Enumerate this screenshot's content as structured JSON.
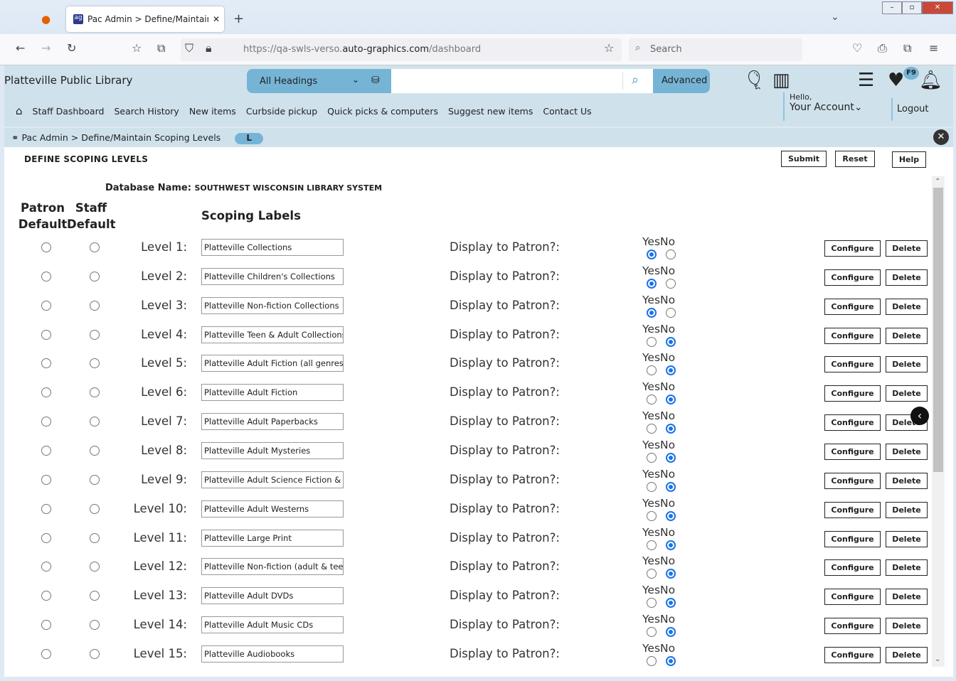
{
  "browser": {
    "tab_title": "Pac Admin > Define/Maintain S",
    "url_prefix": "https://qa-swls-verso.",
    "url_domain": "auto-graphics.com",
    "url_path": "/dashboard",
    "search_placeholder": "Search"
  },
  "header": {
    "library_name": "Platteville Public Library",
    "search_scope": "All Headings",
    "advanced_label": "Advanced",
    "badge": "F9",
    "hello": "Hello,",
    "account": "Your Account",
    "logout": "Logout"
  },
  "menu": [
    "Staff Dashboard",
    "Search History",
    "New items",
    "Curbside pickup",
    "Quick picks & computers",
    "Suggest new items",
    "Contact Us"
  ],
  "breadcrumb": {
    "text": "Pac Admin > Define/Maintain Scoping Levels",
    "pill": "L"
  },
  "page": {
    "title": "DEFINE SCOPING LEVELS",
    "submit": "Submit",
    "reset": "Reset",
    "help": "Help",
    "db_label": "Database Name:",
    "db_value": "SOUTHWEST WISCONSIN LIBRARY SYSTEM",
    "col_patron_1": "Patron",
    "col_patron_2": "Default",
    "col_staff_1": "Staff",
    "col_staff_2": "Default",
    "col_labels": "Scoping Labels",
    "display_label": "Display to Patron?:",
    "yes": "Yes",
    "no": "No",
    "configure": "Configure",
    "delete": "Delete"
  },
  "levels": [
    {
      "level": "Level 1:",
      "label": "Platteville Collections",
      "display": "Yes"
    },
    {
      "level": "Level 2:",
      "label": "Platteville Children's Collections",
      "display": "Yes"
    },
    {
      "level": "Level 3:",
      "label": "Platteville Non-fiction Collections",
      "display": "Yes"
    },
    {
      "level": "Level 4:",
      "label": "Platteville Teen & Adult Collections",
      "display": "No"
    },
    {
      "level": "Level 5:",
      "label": "Platteville Adult Fiction (all genres",
      "display": "No"
    },
    {
      "level": "Level 6:",
      "label": "Platteville Adult Fiction",
      "display": "No"
    },
    {
      "level": "Level 7:",
      "label": "Platteville Adult Paperbacks",
      "display": "No"
    },
    {
      "level": "Level 8:",
      "label": "Platteville Adult Mysteries",
      "display": "No"
    },
    {
      "level": "Level 9:",
      "label": "Platteville Adult Science Fiction &",
      "display": "No"
    },
    {
      "level": "Level 10:",
      "label": "Platteville Adult Westerns",
      "display": "No"
    },
    {
      "level": "Level 11:",
      "label": "Platteville Large Print",
      "display": "No"
    },
    {
      "level": "Level 12:",
      "label": "Platteville Non-fiction (adult & tee",
      "display": "No"
    },
    {
      "level": "Level 13:",
      "label": "Platteville Adult DVDs",
      "display": "No"
    },
    {
      "level": "Level 14:",
      "label": "Platteville Adult Music CDs",
      "display": "No"
    },
    {
      "level": "Level 15:",
      "label": "Platteville Audiobooks",
      "display": "No"
    }
  ]
}
